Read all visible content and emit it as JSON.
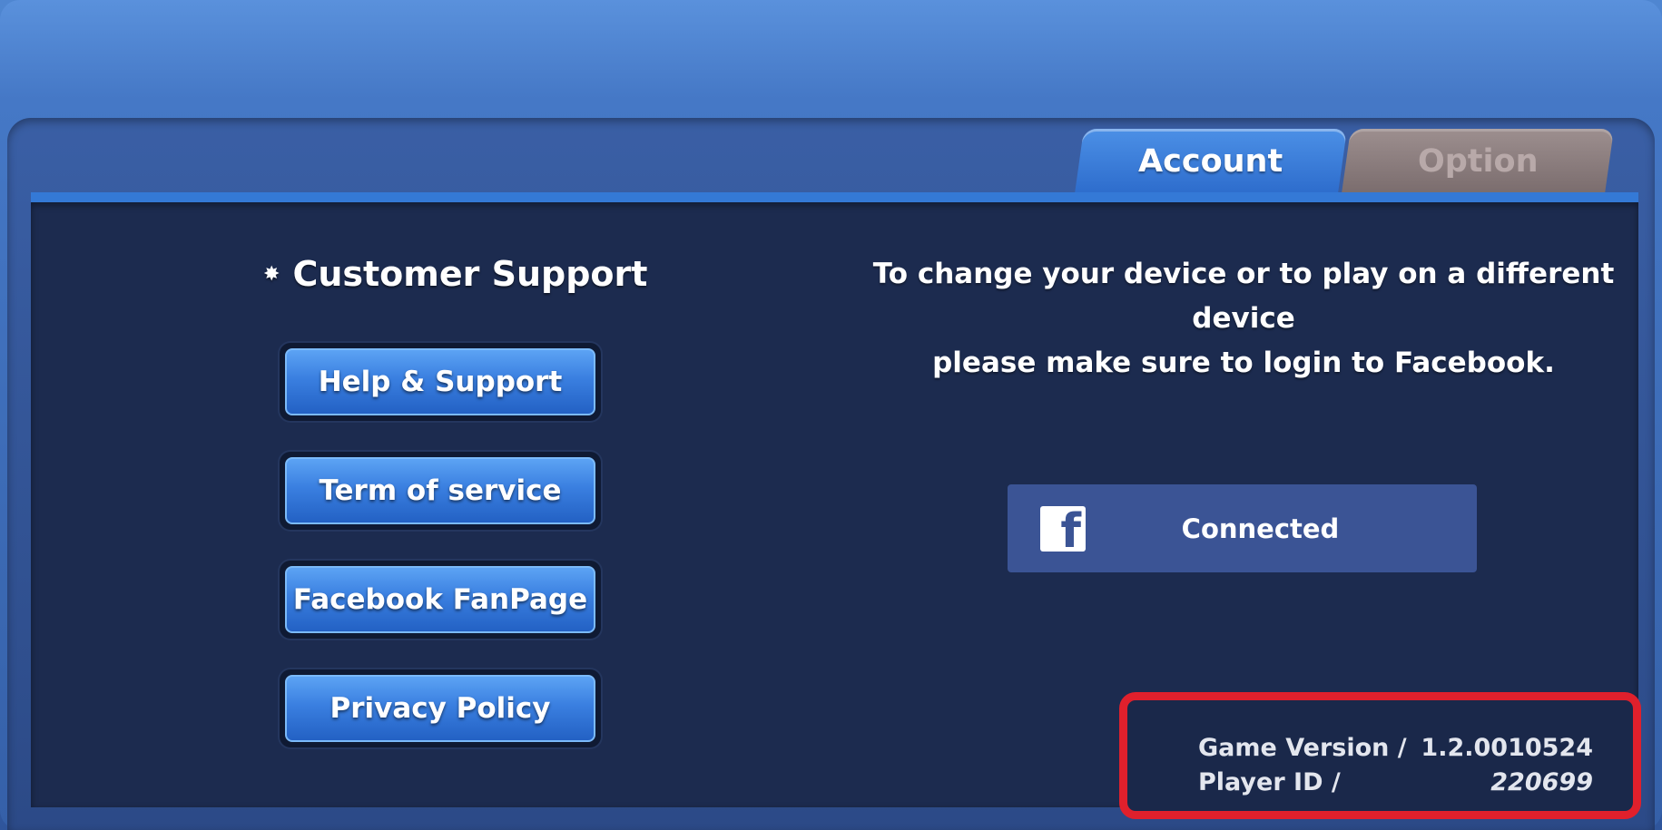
{
  "tabs": {
    "account": "Account",
    "option": "Option"
  },
  "customer_support": {
    "title": "Customer Support",
    "buttons": [
      {
        "label": "Help & Support"
      },
      {
        "label": "Term of service"
      },
      {
        "label": "Facebook FanPage"
      },
      {
        "label": "Privacy Policy"
      }
    ]
  },
  "account": {
    "message_line1": "To change your device or to play on a different device",
    "message_line2": "please make sure to login to Facebook.",
    "facebook_button": "Connected",
    "facebook_icon": "facebook-icon"
  },
  "version_info": {
    "game_version_label": "Game Version /",
    "game_version_value": "1.2.0010524",
    "player_id_label": "Player ID /",
    "player_id_value": "220699"
  },
  "colors": {
    "accent_blue": "#3479d6",
    "panel": "#1c2b4f",
    "facebook": "#3b5495",
    "highlight_red": "#e0202c"
  }
}
